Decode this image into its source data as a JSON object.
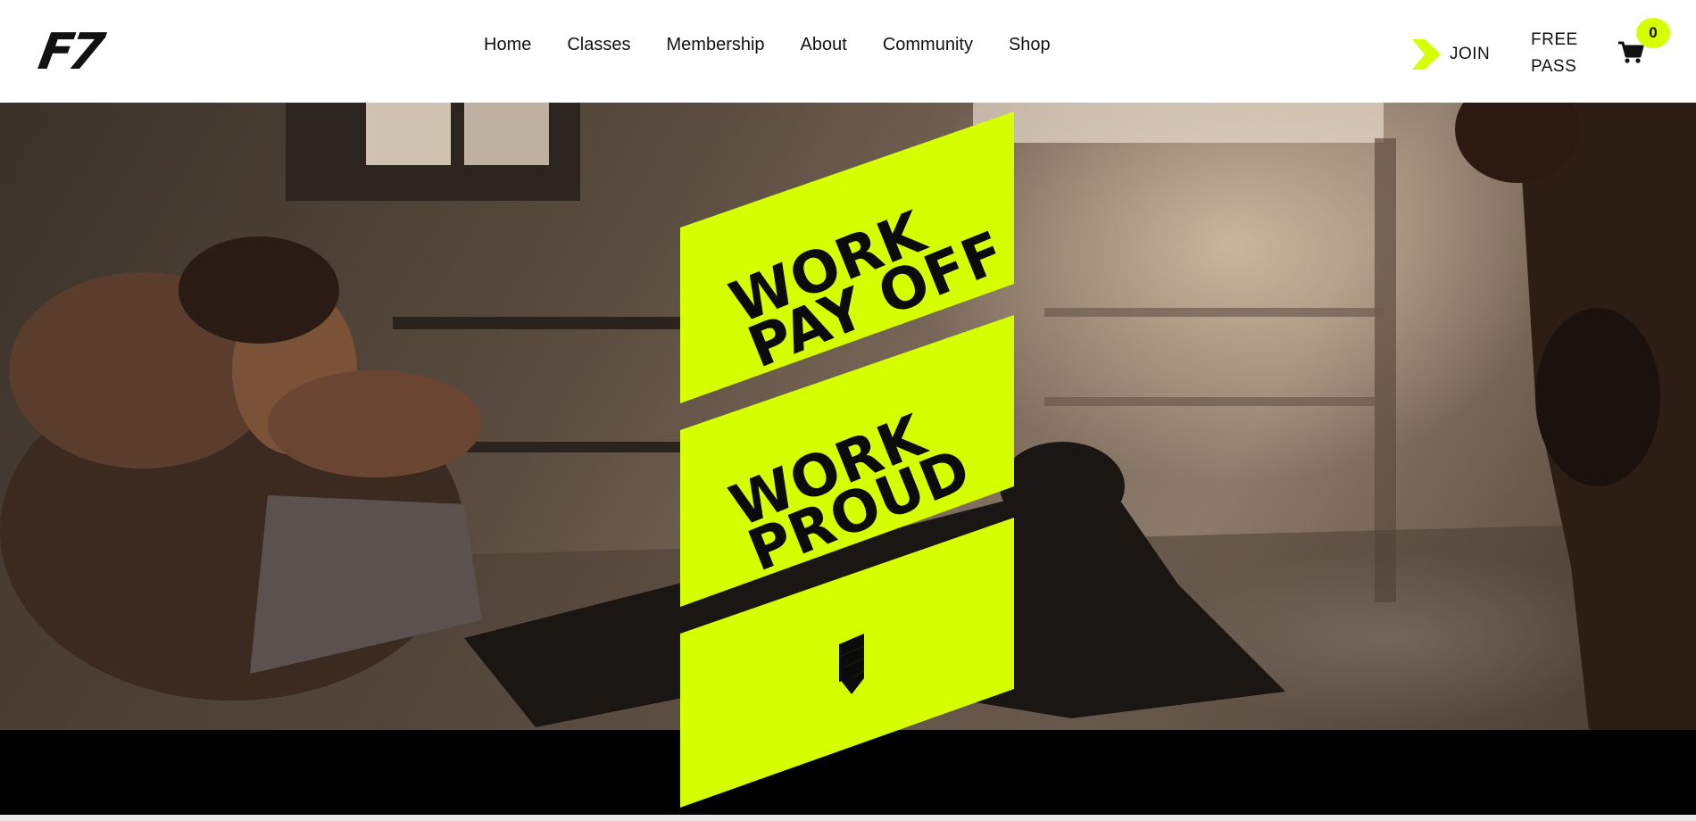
{
  "brand": {
    "logo_text": "F7"
  },
  "nav": {
    "items": [
      {
        "label": "Home"
      },
      {
        "label": "Classes"
      },
      {
        "label": "Membership"
      },
      {
        "label": "About"
      },
      {
        "label": "Community"
      },
      {
        "label": "Shop"
      }
    ]
  },
  "header_actions": {
    "join_label": "JOIN",
    "free_pass_line1": "FREE",
    "free_pass_line2": "PASS",
    "cart_count": "0",
    "cart_icon": "cart-icon",
    "join_icon": "chevron-right-icon"
  },
  "hero": {
    "panel1": {
      "line1": "WORK",
      "line2": "PAY OFF"
    },
    "panel2": {
      "line1": "WORK",
      "line2": "PROUD"
    },
    "scroll_icon": "chevron-down-triple-icon"
  },
  "colors": {
    "accent": "#d6ff00",
    "text": "#111111",
    "band": "#000000"
  }
}
